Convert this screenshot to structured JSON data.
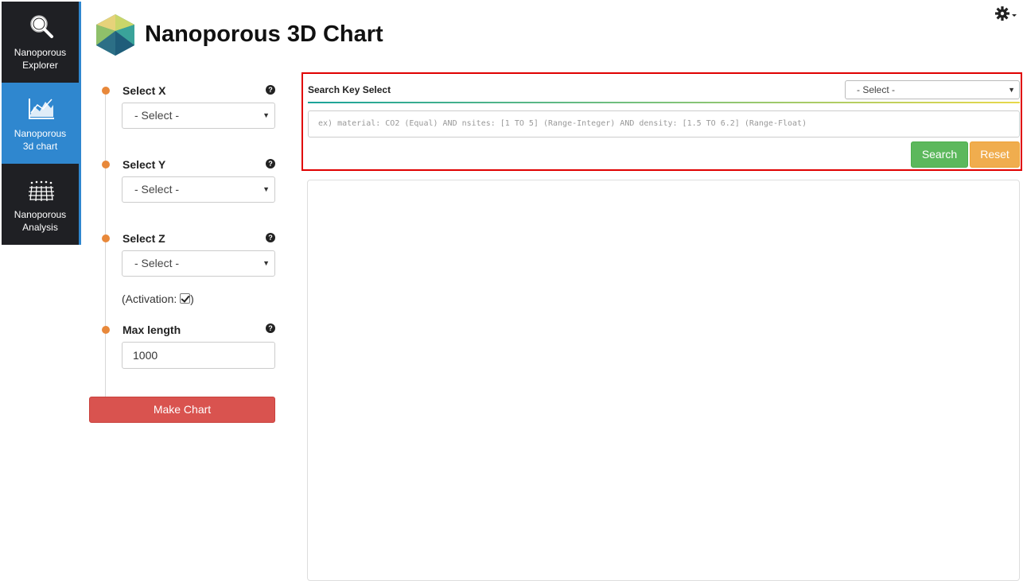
{
  "nav": {
    "items": [
      {
        "label_line1": "Nanoporous",
        "label_line2": "Explorer",
        "icon": "magnifier-icon"
      },
      {
        "label_line1": "Nanoporous",
        "label_line2": "3d chart",
        "icon": "area-chart-icon"
      },
      {
        "label_line1": "Nanoporous",
        "label_line2": "Analysis",
        "icon": "surface-grid-icon"
      }
    ],
    "active_index": 1
  },
  "header": {
    "title": "Nanoporous 3D Chart"
  },
  "form": {
    "select_x": {
      "label": "Select X",
      "value": "- Select -"
    },
    "select_y": {
      "label": "Select Y",
      "value": "- Select -"
    },
    "select_z": {
      "label": "Select Z",
      "value": "- Select -"
    },
    "activation": {
      "prefix": "(Activation:",
      "suffix": ")",
      "checked": true
    },
    "max_length": {
      "label": "Max length",
      "value": "1000"
    },
    "make_chart_label": "Make Chart"
  },
  "search": {
    "key_label": "Search Key Select",
    "key_select_value": "- Select -",
    "query_placeholder": "ex) material: CO2 (Equal) AND nsites: [1 TO 5] (Range-Integer) AND density: [1.5 TO 6.2] (Range-Float)",
    "search_label": "Search",
    "reset_label": "Reset"
  },
  "colors": {
    "nav_bg": "#1f2024",
    "nav_active": "#2f87cf",
    "timeline_dot": "#e8883a",
    "make_chart": "#d9534f",
    "search_btn": "#5cb85c",
    "reset_btn": "#f0ad4e",
    "highlight_border": "#e00000"
  }
}
